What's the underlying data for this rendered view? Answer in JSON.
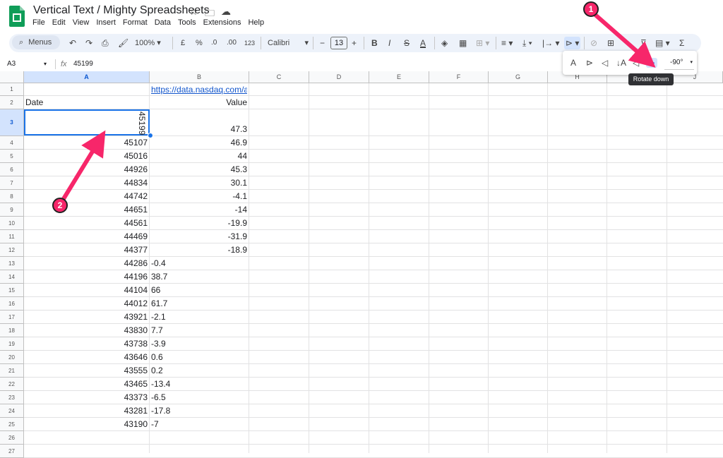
{
  "app": {
    "title": "Vertical Text / Mighty Spreadsheets"
  },
  "menu": [
    "File",
    "Edit",
    "View",
    "Insert",
    "Format",
    "Data",
    "Tools",
    "Extensions",
    "Help"
  ],
  "toolbar": {
    "menus_label": "Menus",
    "zoom": "100%",
    "currency": "£",
    "percent": "%",
    "dec_decrease": ".0",
    "dec_increase": ".00",
    "number_format": "123",
    "font": "Calibri",
    "font_size": "13"
  },
  "formula_bar": {
    "cell_ref": "A3",
    "value": "45199"
  },
  "columns": [
    "A",
    "B",
    "C",
    "D",
    "E",
    "F",
    "G",
    "H",
    "I",
    "J"
  ],
  "rows": [
    {
      "n": "1",
      "a": "",
      "b": "https://data.nasdaq.com/ap"
    },
    {
      "n": "2",
      "a": "Date",
      "b": "Value"
    },
    {
      "n": "3",
      "a": "45199",
      "b": "47.3"
    },
    {
      "n": "4",
      "a": "45107",
      "b": "46.9"
    },
    {
      "n": "5",
      "a": "45016",
      "b": "44"
    },
    {
      "n": "6",
      "a": "44926",
      "b": "45.3"
    },
    {
      "n": "7",
      "a": "44834",
      "b": "30.1"
    },
    {
      "n": "8",
      "a": "44742",
      "b": "-4.1"
    },
    {
      "n": "9",
      "a": "44651",
      "b": "-14"
    },
    {
      "n": "10",
      "a": "44561",
      "b": "-19.9"
    },
    {
      "n": "11",
      "a": "44469",
      "b": "-31.9"
    },
    {
      "n": "12",
      "a": "44377",
      "b": "-18.9"
    },
    {
      "n": "13",
      "a": "44286",
      "b": "-0.4"
    },
    {
      "n": "14",
      "a": "44196",
      "b": "38.7"
    },
    {
      "n": "15",
      "a": "44104",
      "b": "66"
    },
    {
      "n": "16",
      "a": "44012",
      "b": "61.7"
    },
    {
      "n": "17",
      "a": "43921",
      "b": "-2.1"
    },
    {
      "n": "18",
      "a": "43830",
      "b": "7.7"
    },
    {
      "n": "19",
      "a": "43738",
      "b": "-3.9"
    },
    {
      "n": "20",
      "a": "43646",
      "b": "0.6"
    },
    {
      "n": "21",
      "a": "43555",
      "b": "0.2"
    },
    {
      "n": "22",
      "a": "43465",
      "b": "-13.4"
    },
    {
      "n": "23",
      "a": "43373",
      "b": "-6.5"
    },
    {
      "n": "24",
      "a": "43281",
      "b": "-17.8"
    },
    {
      "n": "25",
      "a": "43190",
      "b": "-7"
    },
    {
      "n": "26",
      "a": "",
      "b": ""
    },
    {
      "n": "27",
      "a": "",
      "b": ""
    }
  ],
  "rotation_menu": {
    "angle": "-90°",
    "tooltip": "Rotate down"
  },
  "annotations": {
    "badge1": "1",
    "badge2": "2",
    "color": "#f7266a"
  }
}
